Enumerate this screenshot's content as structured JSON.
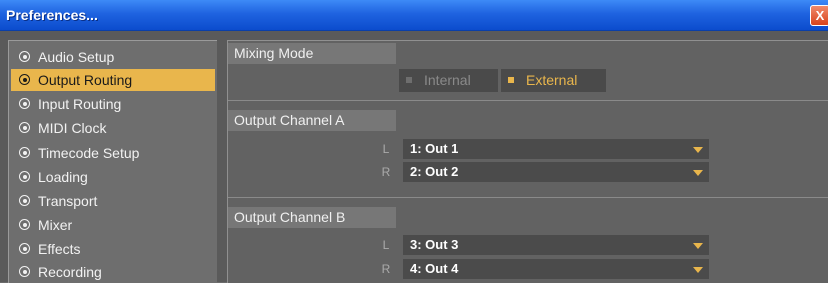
{
  "window": {
    "title": "Preferences...",
    "close_label": "X"
  },
  "sidebar": {
    "items": [
      {
        "label": "Audio Setup",
        "active": false
      },
      {
        "label": "Output Routing",
        "active": true
      },
      {
        "label": "Input Routing",
        "active": false
      },
      {
        "label": "MIDI Clock",
        "active": false
      },
      {
        "label": "Timecode Setup",
        "active": false
      },
      {
        "label": "Loading",
        "active": false
      },
      {
        "label": "Transport",
        "active": false
      },
      {
        "label": "Mixer",
        "active": false
      },
      {
        "label": "Effects",
        "active": false
      },
      {
        "label": "Recording",
        "active": false
      }
    ]
  },
  "mixing_mode": {
    "heading": "Mixing Mode",
    "options": [
      "Internal",
      "External"
    ],
    "selected": "External"
  },
  "output_a": {
    "heading": "Output Channel A",
    "left_label": "L",
    "left_value": "1: Out 1",
    "right_label": "R",
    "right_value": "2: Out 2"
  },
  "output_b": {
    "heading": "Output Channel B",
    "left_label": "L",
    "left_value": "3: Out 3",
    "right_label": "R",
    "right_value": "4: Out 4"
  },
  "colors": {
    "accent": "#e9b64c",
    "titlebar": "#1f63e0",
    "inactive_option": "#8a8a8a"
  }
}
